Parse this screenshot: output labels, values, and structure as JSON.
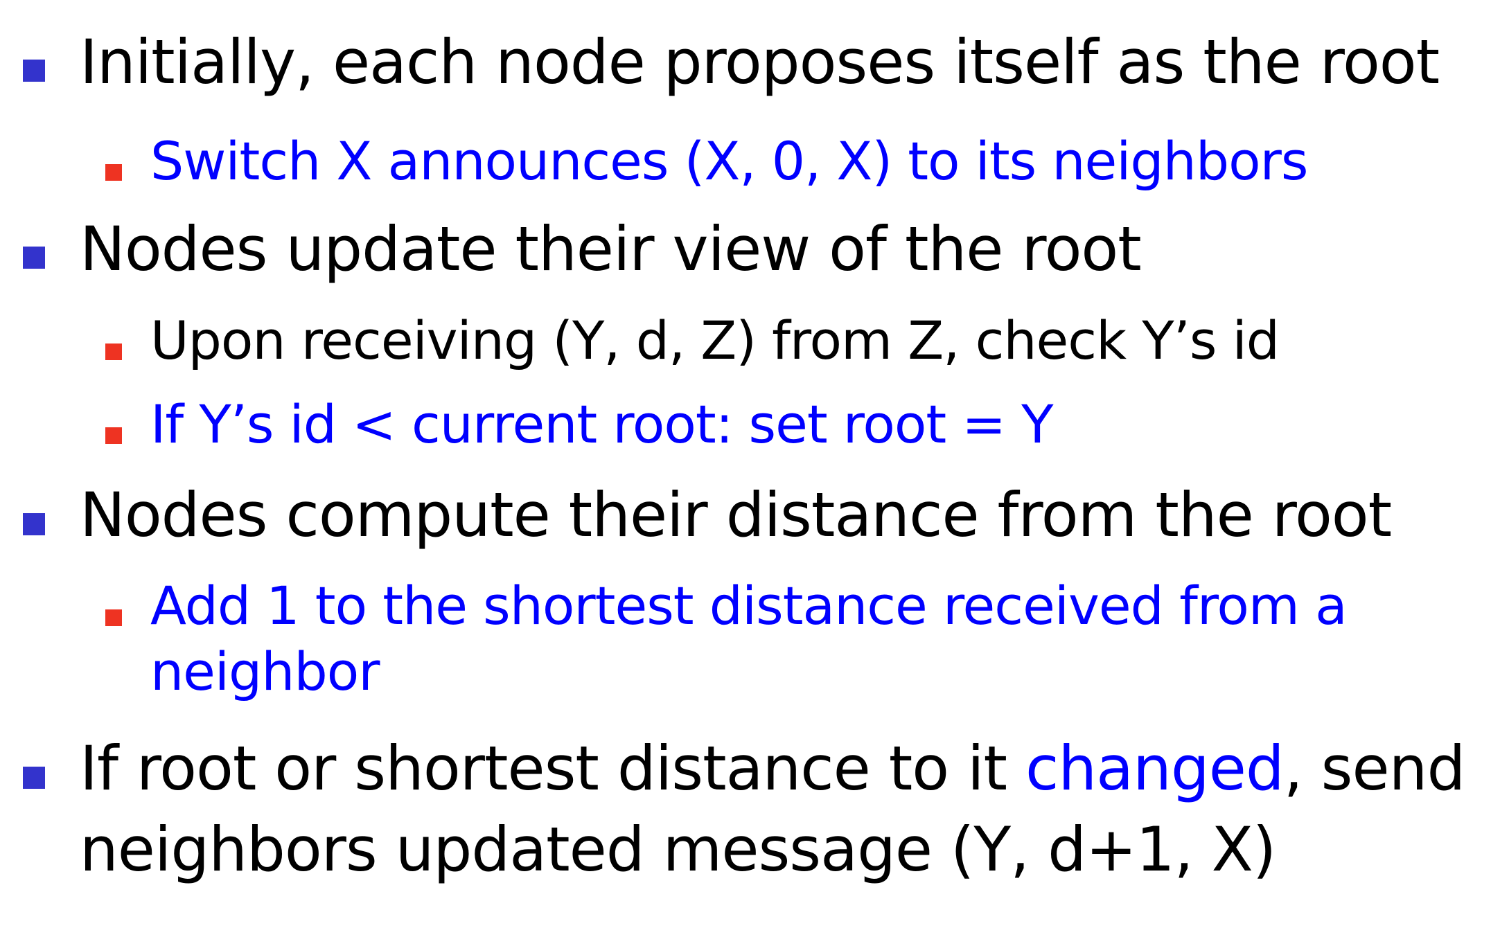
{
  "bullets": [
    {
      "text": "Initially, each node proposes itself as the root",
      "sub": [
        {
          "text": "Switch X announces (X, 0, X) to its neighbors"
        }
      ]
    },
    {
      "text": "Nodes update their view of the root",
      "sub": [
        {
          "text": "Upon receiving (Y, d, Z) from Z, check Y’s id"
        },
        {
          "text": "If Y’s id  < current root: set root = Y"
        }
      ]
    },
    {
      "text": "Nodes compute their distance from the root",
      "sub": [
        {
          "line1": "Add 1 to the shortest distance received from a",
          "line2": "neighbor"
        }
      ]
    },
    {
      "text_before": "If root or shortest distance to it ",
      "highlight": "changed",
      "text_after": ", send",
      "line2": "neighbors updated message (Y, d+1, X)"
    }
  ],
  "colors": {
    "main_text": "#000000",
    "highlight_text": "#0000ff",
    "level1_bullet": "#3333cc",
    "level2_bullet": "#ee3322"
  }
}
